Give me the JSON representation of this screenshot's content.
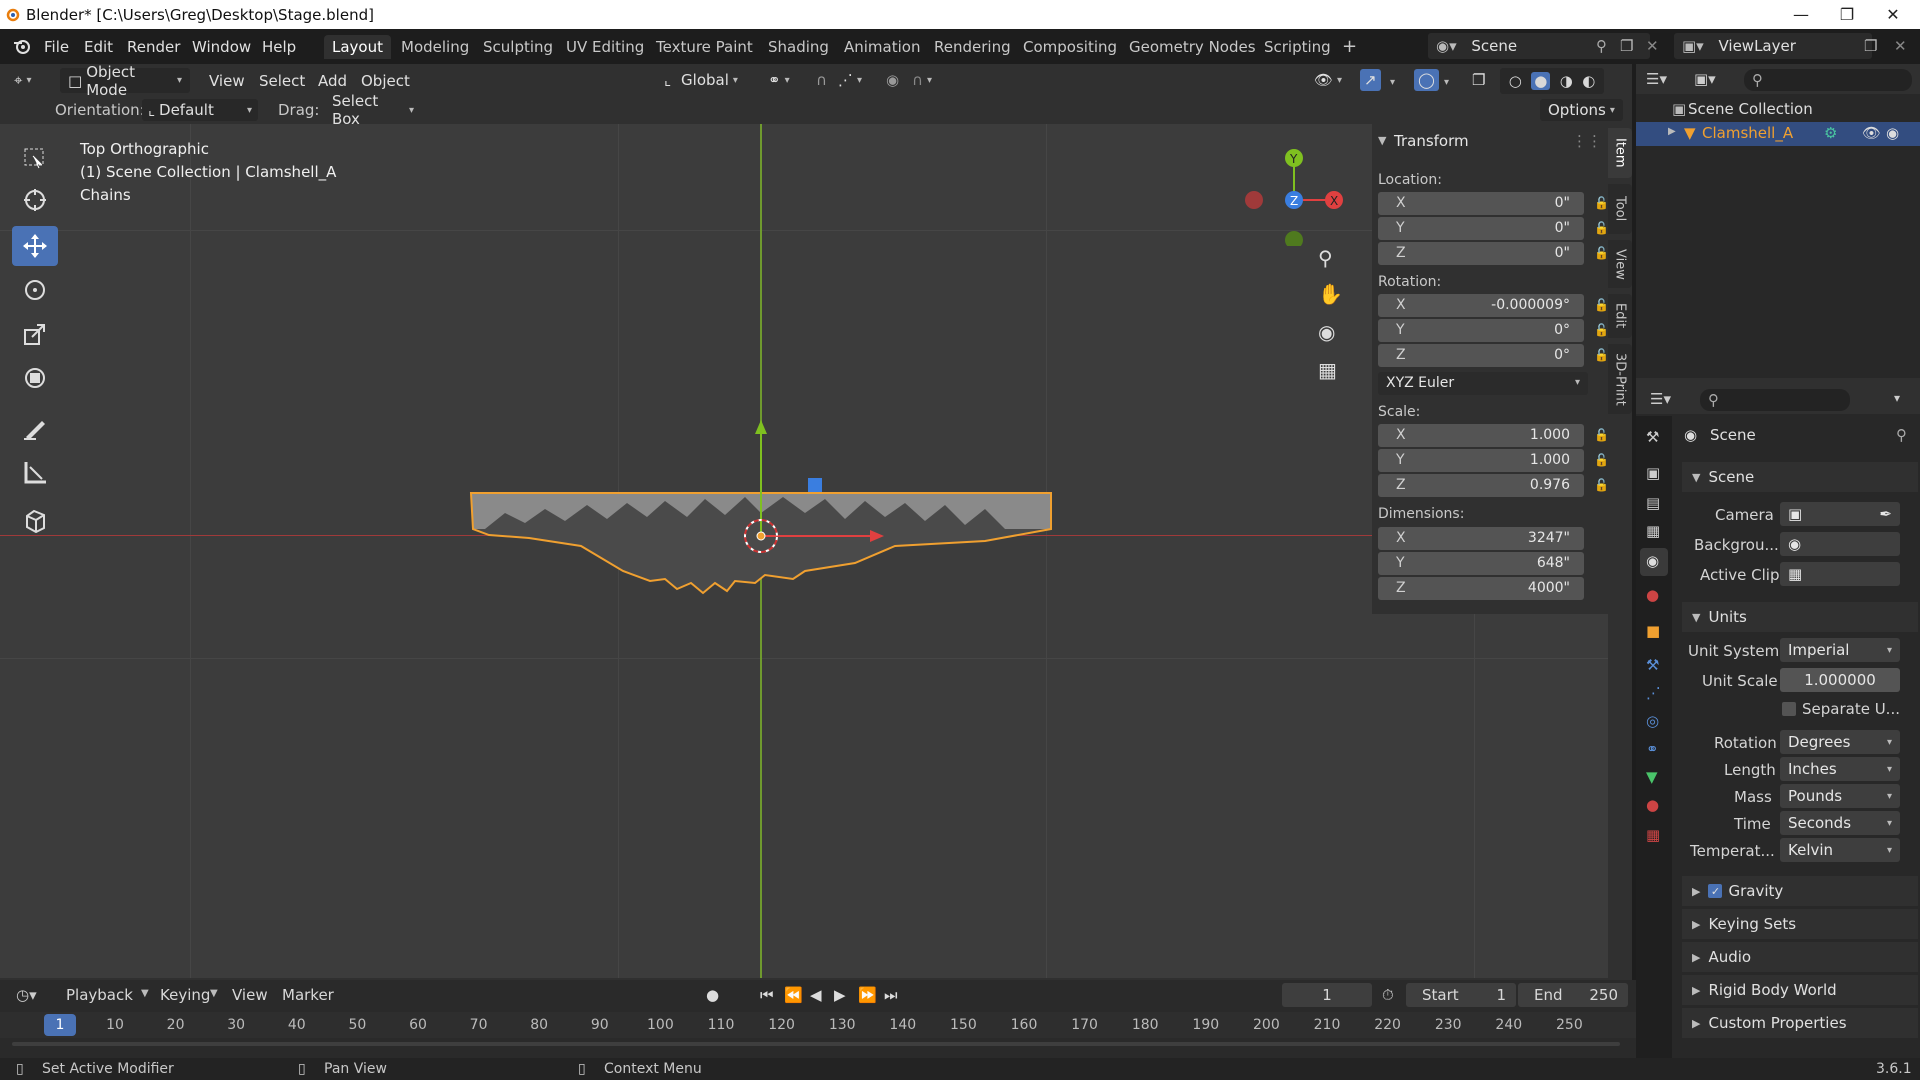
{
  "window": {
    "title": "Blender* [C:\\Users\\Greg\\Desktop\\Stage.blend]"
  },
  "menu": [
    "File",
    "Edit",
    "Render",
    "Window",
    "Help"
  ],
  "workspaces": [
    "Layout",
    "Modeling",
    "Sculpting",
    "UV Editing",
    "Texture Paint",
    "Shading",
    "Animation",
    "Rendering",
    "Compositing",
    "Geometry Nodes",
    "Scripting"
  ],
  "active_workspace": "Layout",
  "scene_name": "Scene",
  "view_layer": "ViewLayer",
  "viewport_header": {
    "mode": "Object Mode",
    "menus": [
      "View",
      "Select",
      "Add",
      "Object"
    ],
    "transform_orientation": "Global",
    "orientation_label": "Orientation:",
    "orientation_value": "Default",
    "drag_label": "Drag:",
    "drag_value": "Select Box",
    "options": "Options"
  },
  "viewport_info": {
    "line1": "Top Orthographic",
    "line2": "(1) Scene Collection | Clamshell_A",
    "line3": "Chains"
  },
  "gizmo": {
    "y": "Y",
    "z": "Z",
    "x": "X"
  },
  "transform": {
    "header": "Transform",
    "location_label": "Location:",
    "location": {
      "x": "0\"",
      "y": "0\"",
      "z": "0\""
    },
    "rotation_label": "Rotation:",
    "rotation": {
      "x": "-0.000009°",
      "y": "0°",
      "z": "0°"
    },
    "rotation_mode": "XYZ Euler",
    "scale_label": "Scale:",
    "scale": {
      "x": "1.000",
      "y": "1.000",
      "z": "0.976"
    },
    "dimensions_label": "Dimensions:",
    "dimensions": {
      "x": "3247\"",
      "y": "648\"",
      "z": "4000\""
    },
    "axes": {
      "x": "X",
      "y": "Y",
      "z": "Z"
    }
  },
  "side_tabs": [
    "Item",
    "Tool",
    "View",
    "Edit",
    "3D-Print"
  ],
  "outliner": {
    "root": "Scene Collection",
    "item": "Clamshell_A"
  },
  "properties": {
    "context": "Scene",
    "panel_scene": "Scene",
    "camera_label": "Camera",
    "background_label": "Backgrou...",
    "active_clip_label": "Active Clip",
    "units_panel": "Units",
    "unit_system_label": "Unit System",
    "unit_system": "Imperial",
    "unit_scale_label": "Unit Scale",
    "unit_scale": "1.000000",
    "separate_units": "Separate U...",
    "rotation_label": "Rotation",
    "rotation": "Degrees",
    "length_label": "Length",
    "length": "Inches",
    "mass_label": "Mass",
    "mass": "Pounds",
    "time_label": "Time",
    "time": "Seconds",
    "temperature_label": "Temperat...",
    "temperature": "Kelvin",
    "gravity": "Gravity",
    "keying_sets": "Keying Sets",
    "audio": "Audio",
    "rigid_body_world": "Rigid Body World",
    "custom_properties": "Custom Properties"
  },
  "timeline": {
    "menus": [
      "Playback",
      "Keying",
      "View",
      "Marker"
    ],
    "current_frame": "1",
    "start_label": "Start",
    "start": "1",
    "end_label": "End",
    "end": "250",
    "ticks": [
      "1",
      "10",
      "20",
      "30",
      "40",
      "50",
      "60",
      "70",
      "80",
      "90",
      "100",
      "110",
      "120",
      "130",
      "140",
      "150",
      "160",
      "170",
      "180",
      "190",
      "200",
      "210",
      "220",
      "230",
      "240",
      "250"
    ]
  },
  "status": {
    "left": "Set Active Modifier",
    "middle": "Pan View",
    "right": "Context Menu",
    "version": "3.6.1"
  },
  "colors": {
    "accent": "#4a72b5",
    "selected_outline": "#f0a030",
    "x_axis": "#e04040",
    "y_axis": "#7fc020",
    "z_axis": "#3a7ee0"
  }
}
